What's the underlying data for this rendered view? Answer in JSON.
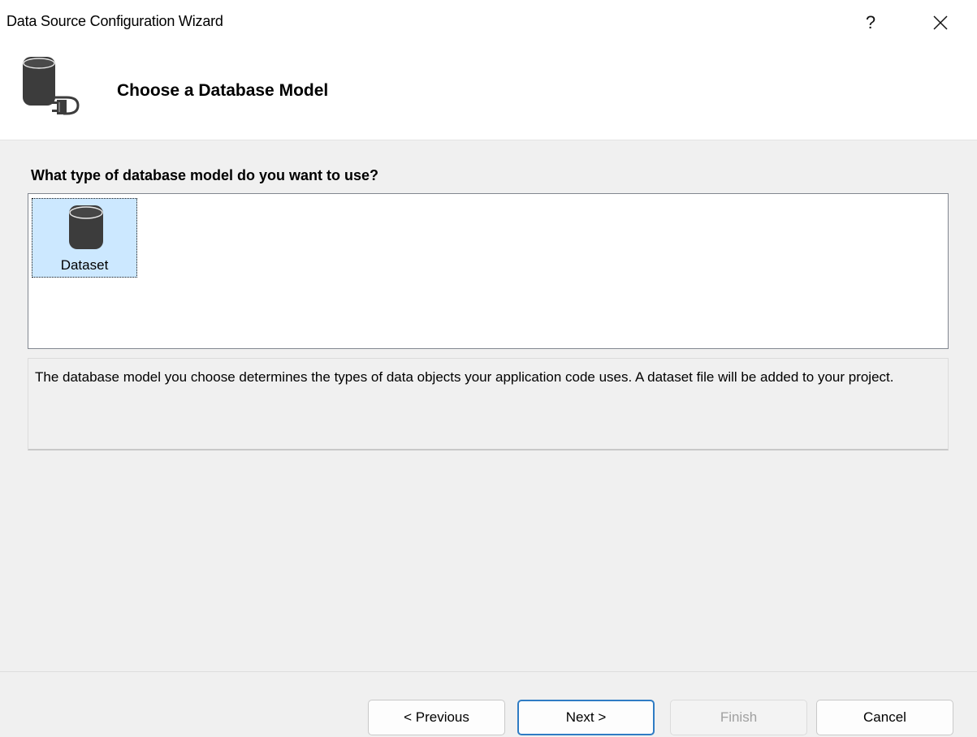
{
  "window": {
    "title": "Data Source Configuration Wizard",
    "help_label": "?",
    "close_icon": "close-icon"
  },
  "header": {
    "title": "Choose a Database Model",
    "icon": "database-connector-icon"
  },
  "prompt": {
    "question": "What type of database model do you want to use?"
  },
  "models": [
    {
      "label": "Dataset",
      "icon": "database-icon",
      "selected": true
    }
  ],
  "description": {
    "text": "The database model you choose determines the types of data objects your application code uses. A dataset file will be added to your project."
  },
  "buttons": {
    "previous": "< Previous",
    "next": "Next >",
    "finish": "Finish",
    "cancel": "Cancel"
  },
  "colors": {
    "selection_background": "#cce8ff",
    "default_button_border": "#2f7cc4",
    "database_icon": "#3c3c3c"
  }
}
